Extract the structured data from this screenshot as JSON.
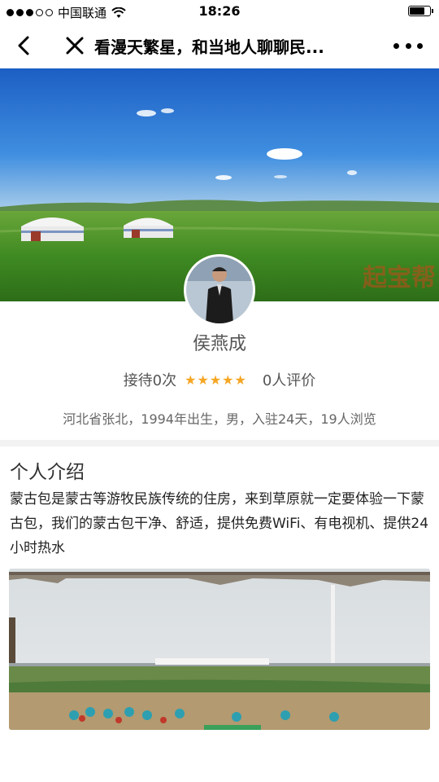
{
  "status_bar": {
    "carrier": "中国联通",
    "time": "18:26"
  },
  "nav": {
    "title": "看漫天繁星，和当地人聊聊民..."
  },
  "hero": {
    "watermark": "起宝帮"
  },
  "profile": {
    "name": "侯燕成",
    "reception": "接待0次",
    "rating": 5,
    "reviews": "0人评价",
    "info": "河北省张北，1994年出生，男，入驻24天，19人浏览"
  },
  "intro": {
    "title": "个人介绍",
    "text": "蒙古包是蒙古等游牧民族传统的住房，来到草原就一定要体验一下蒙古包，我们的蒙古包干净、舒适，提供免费WiFi、有电视机、提供24小时热水"
  },
  "colors": {
    "star": "#f5a623",
    "divider": "#f2f2f2"
  }
}
